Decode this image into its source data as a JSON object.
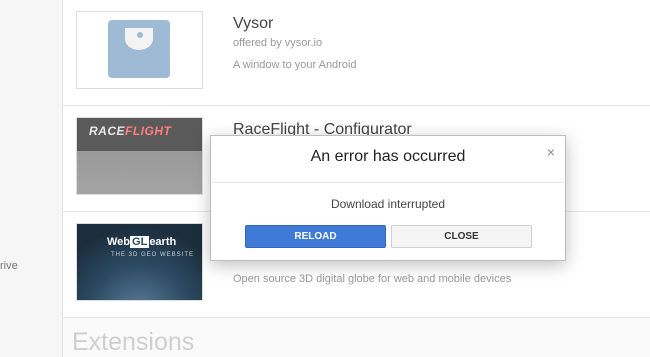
{
  "sidebar": {
    "partial_text": "rive"
  },
  "apps": [
    {
      "title": "Vysor",
      "offered_by": "offered by vysor.io",
      "description": "A window to your Android",
      "icon": "vysor-logo-icon"
    },
    {
      "title": "RaceFlight - Configurator",
      "offered_by": "",
      "description": "",
      "icon": "raceflight-logo-icon",
      "logo_text_a": "RACE",
      "logo_text_b": "FLIGHT"
    },
    {
      "title": "",
      "offered_by": "",
      "description": "Open source 3D digital globe for web and mobile devices",
      "icon": "webglearth-logo-icon",
      "logo_text_a": "Web",
      "logo_text_b": "GL",
      "logo_text_c": "earth",
      "logo_tag": "THE 3D GEO WEBSITE"
    }
  ],
  "section": {
    "heading": "Extensions"
  },
  "dialog": {
    "title": "An error has occurred",
    "message": "Download interrupted",
    "reload_label": "RELOAD",
    "close_label": "CLOSE",
    "close_icon": "×"
  },
  "colors": {
    "primary_button": "#3f7ad6",
    "secondary_button": "#f5f5f5"
  }
}
